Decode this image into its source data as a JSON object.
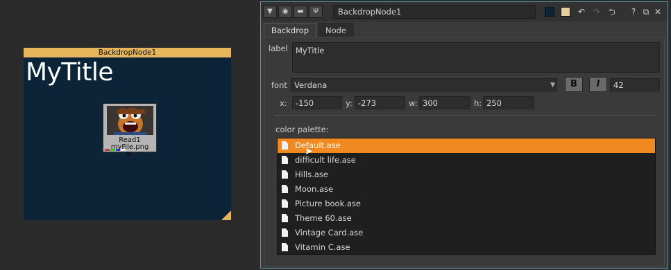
{
  "graph": {
    "backdrop": {
      "name": "BackdropNode1",
      "title": "MyTitle",
      "color": "#e5b65c",
      "background": "#0b2438"
    },
    "read_node": {
      "label": "Read1",
      "file": "myFile.png"
    }
  },
  "panel": {
    "node_name": "BackdropNode1",
    "toolbar_icons": [
      "collapse-triangle-icon",
      "viewer-icon",
      "gizmo-icon",
      "wrench-icon"
    ],
    "right_icons": [
      "color-swatch-icon",
      "tile-color-icon",
      "undo-icon",
      "redo-icon",
      "revert-icon",
      "help-icon",
      "float-icon",
      "close-icon"
    ],
    "help_label": "?",
    "close_label": "✕",
    "tabs": [
      {
        "label": "Backdrop",
        "active": true
      },
      {
        "label": "Node",
        "active": false
      }
    ],
    "fields": {
      "label_label": "label",
      "label_value": "MyTitle",
      "font_label": "font",
      "font_value": "Verdana",
      "bold_label": "B",
      "italic_label": "I",
      "font_size": "42",
      "x_label": "x:",
      "x_value": "-150",
      "y_label": "y:",
      "y_value": "-273",
      "w_label": "w:",
      "w_value": "300",
      "h_label": "h:",
      "h_value": "250"
    },
    "color_palette": {
      "label": "color palette:",
      "items": [
        {
          "name": "Default.ase",
          "selected": true
        },
        {
          "name": "difficult life.ase",
          "selected": false
        },
        {
          "name": "Hills.ase",
          "selected": false
        },
        {
          "name": "Moon.ase",
          "selected": false
        },
        {
          "name": "Picture book.ase",
          "selected": false
        },
        {
          "name": "Theme 60.ase",
          "selected": false
        },
        {
          "name": "Vintage Card.ase",
          "selected": false
        },
        {
          "name": "Vitamin C.ase",
          "selected": false
        }
      ],
      "selected_color": "#f0891f"
    }
  }
}
